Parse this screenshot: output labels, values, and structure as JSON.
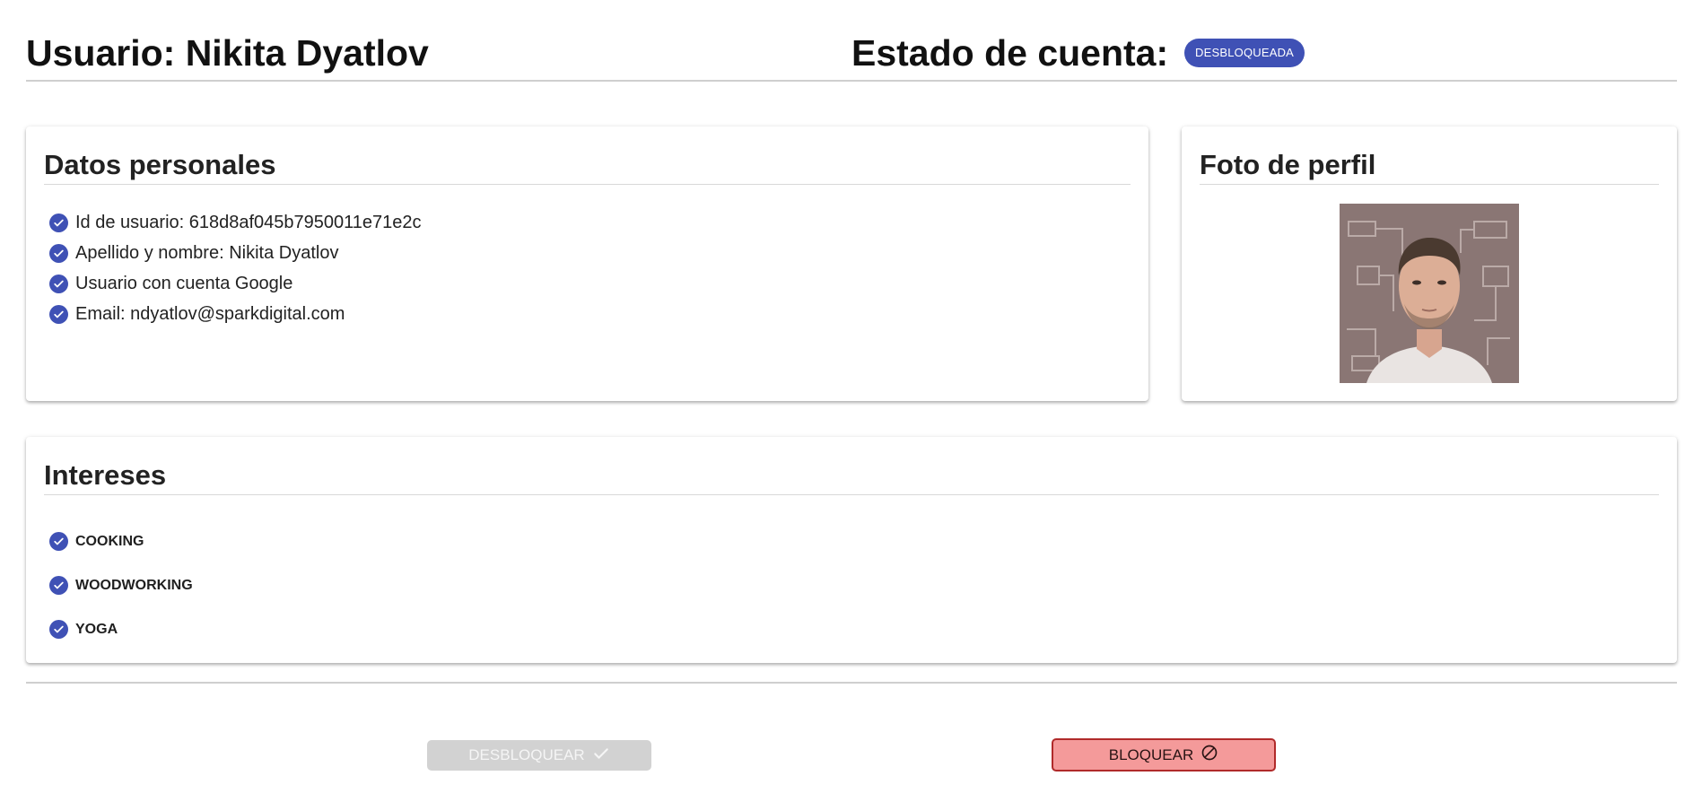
{
  "header": {
    "user_title": "Usuario: Nikita Dyatlov",
    "status_title": "Estado de cuenta:",
    "status_badge": "DESBLOQUEADA"
  },
  "personal": {
    "title": "Datos personales",
    "items": [
      "Id de usuario: 618d8af045b7950011e71e2c",
      "Apellido y nombre: Nikita Dyatlov",
      "Usuario con cuenta Google",
      "Email: ndyatlov@sparkdigital.com"
    ]
  },
  "photo": {
    "title": "Foto de perfil"
  },
  "interests": {
    "title": "Intereses",
    "items": [
      "COOKING",
      "WOODWORKING",
      "YOGA"
    ]
  },
  "actions": {
    "unblock_label": "DESBLOQUEAR",
    "block_label": "BLOQUEAR"
  },
  "colors": {
    "primary": "#3f51b5",
    "disabled": "#d2d2d2",
    "danger_bg": "#f49a9a",
    "danger_border": "#b02a2a"
  },
  "icons": [
    "check-circle-icon",
    "checkmark-icon",
    "block-icon"
  ]
}
